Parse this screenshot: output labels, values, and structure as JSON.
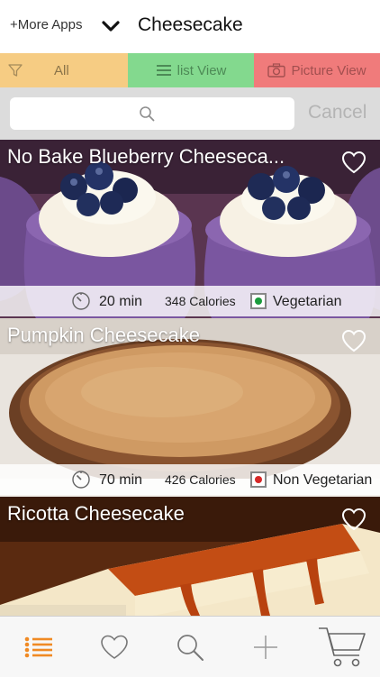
{
  "header": {
    "more_apps": "+More Apps",
    "title": "Cheesecake"
  },
  "filters": {
    "all": "All",
    "list_view": "list View",
    "picture_view": "Picture View"
  },
  "search": {
    "placeholder": "",
    "cancel": "Cancel"
  },
  "recipes": [
    {
      "name": "No Bake Blueberry Cheeseca...",
      "time": "20 min",
      "calories": "348 Calories",
      "diet": "Vegetarian",
      "diet_color": "#1a9b3c"
    },
    {
      "name": "Pumpkin Cheesecake",
      "time": "70 min",
      "calories": "426 Calories",
      "diet": "Non Vegetarian",
      "diet_color": "#d62828"
    },
    {
      "name": "Ricotta Cheesecake"
    }
  ],
  "colors": {
    "all_tab": "#f6cc83",
    "list_tab": "#83d98e",
    "picture_tab": "#f07b7b",
    "accent": "#f08a24"
  },
  "tabbar": {
    "icons": [
      "list-icon",
      "heart-icon",
      "search-icon",
      "plus-icon",
      "cart-icon"
    ]
  }
}
